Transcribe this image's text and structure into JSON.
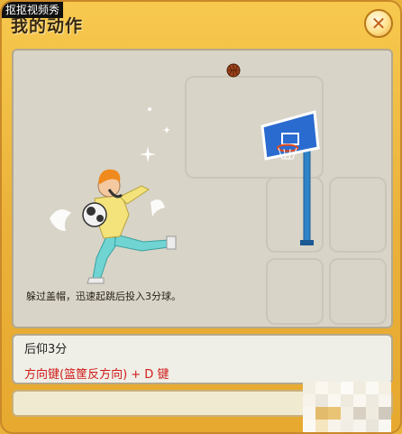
{
  "watermark": "抠抠视频秀",
  "window": {
    "title": "我的动作"
  },
  "stage": {
    "description": "躲过盖帽，迅速起跳后投入3分球。"
  },
  "move": {
    "name": "后仰3分",
    "keys": "方向键(篮筐反方向) + D 键"
  },
  "colors": {
    "frame": "#eab038",
    "keys_text": "#d11a1a",
    "backboard": "#2a6bd0"
  },
  "icons": [
    "close-icon",
    "basketball-icon",
    "basketball-hoop-icon"
  ]
}
